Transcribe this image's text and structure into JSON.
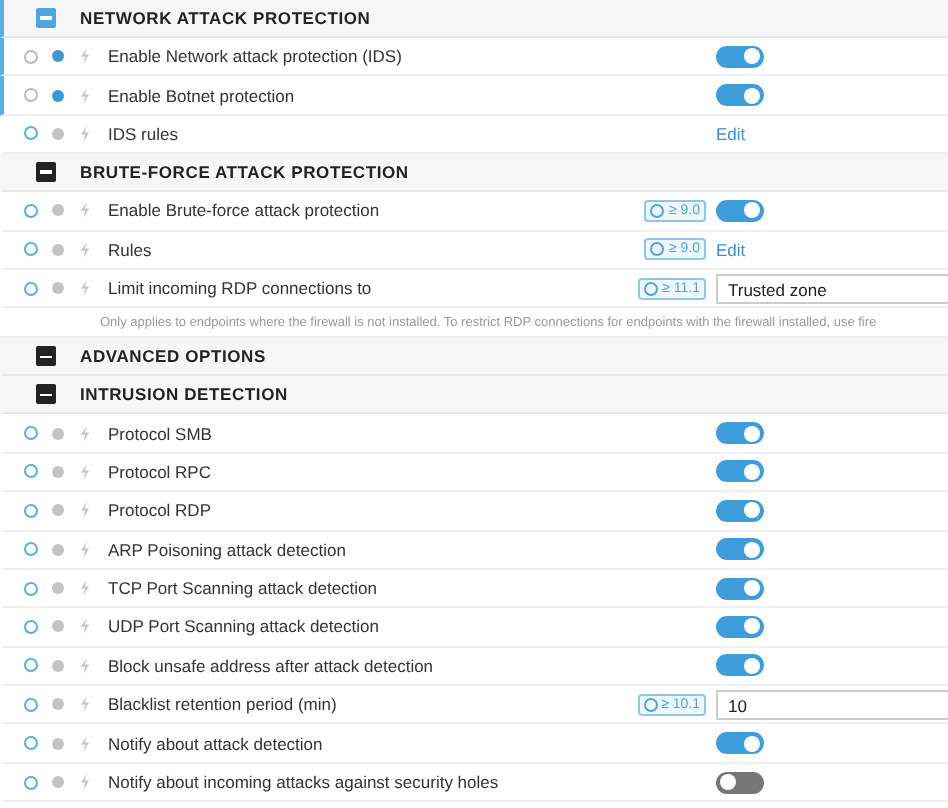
{
  "sections": [
    {
      "title": "NETWORK ATTACK PROTECTION",
      "selected": true,
      "settings": [
        {
          "label": "Enable Network attack protection (IDS)",
          "selected": true,
          "control": {
            "kind": "toggle",
            "on": true
          }
        },
        {
          "label": "Enable Botnet protection",
          "selected": true,
          "control": {
            "kind": "toggle",
            "on": true
          }
        },
        {
          "label": "IDS rules",
          "selected": false,
          "control": {
            "kind": "link",
            "text": "Edit"
          }
        }
      ]
    },
    {
      "title": "BRUTE-FORCE ATTACK PROTECTION",
      "selected": false,
      "settings": [
        {
          "label": "Enable Brute-force attack protection",
          "selected": false,
          "badge": "≥ 9.0",
          "control": {
            "kind": "toggle",
            "on": true
          }
        },
        {
          "label": "Rules",
          "selected": false,
          "badge": "≥ 9.0",
          "control": {
            "kind": "link",
            "text": "Edit"
          }
        },
        {
          "label": "Limit incoming RDP connections to",
          "selected": false,
          "badge": "≥ 11.1",
          "control": {
            "kind": "select",
            "value": "Trusted zone"
          },
          "note": "Only applies to endpoints where the firewall is not installed. To restrict RDP connections for endpoints with the firewall installed, use fire"
        }
      ]
    },
    {
      "title": "ADVANCED OPTIONS",
      "selected": false
    },
    {
      "title": "INTRUSION DETECTION",
      "selected": false,
      "settings": [
        {
          "label": "Protocol SMB",
          "selected": false,
          "control": {
            "kind": "toggle",
            "on": true
          }
        },
        {
          "label": "Protocol RPC",
          "selected": false,
          "control": {
            "kind": "toggle",
            "on": true
          }
        },
        {
          "label": "Protocol RDP",
          "selected": false,
          "control": {
            "kind": "toggle",
            "on": true
          }
        },
        {
          "label": "ARP Poisoning attack detection",
          "selected": false,
          "control": {
            "kind": "toggle",
            "on": true
          }
        },
        {
          "label": "TCP Port Scanning attack detection",
          "selected": false,
          "control": {
            "kind": "toggle",
            "on": true
          }
        },
        {
          "label": "UDP Port Scanning attack detection",
          "selected": false,
          "control": {
            "kind": "toggle",
            "on": true
          }
        },
        {
          "label": "Block unsafe address after attack detection",
          "selected": false,
          "control": {
            "kind": "toggle",
            "on": true
          }
        },
        {
          "label": "Blacklist retention period (min)",
          "selected": false,
          "badge": "≥ 10.1",
          "control": {
            "kind": "input",
            "value": "10"
          }
        },
        {
          "label": "Notify about attack detection",
          "selected": false,
          "control": {
            "kind": "toggle",
            "on": true
          }
        },
        {
          "label": "Notify about incoming attacks against security holes",
          "selected": false,
          "control": {
            "kind": "toggle",
            "on": false
          }
        }
      ]
    }
  ]
}
